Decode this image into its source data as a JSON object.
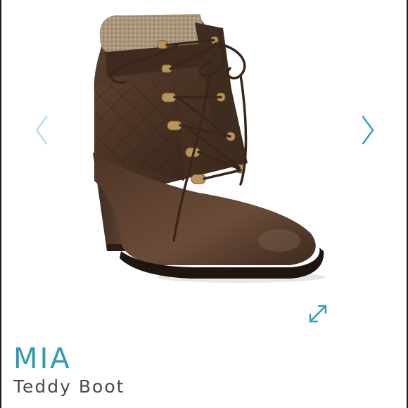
{
  "carousel": {
    "prev_icon": "chevron-left-icon",
    "next_icon": "chevron-right-icon",
    "expand_icon": "expand-icon",
    "arrow_color": "#a9d9e6",
    "next_arrow_color": "#3a9fbd",
    "accent_color": "#2f9bb5"
  },
  "product": {
    "brand": "MIA",
    "name": "Teddy Boot",
    "image": "brown-lace-up-heeled-ankle-boot"
  }
}
